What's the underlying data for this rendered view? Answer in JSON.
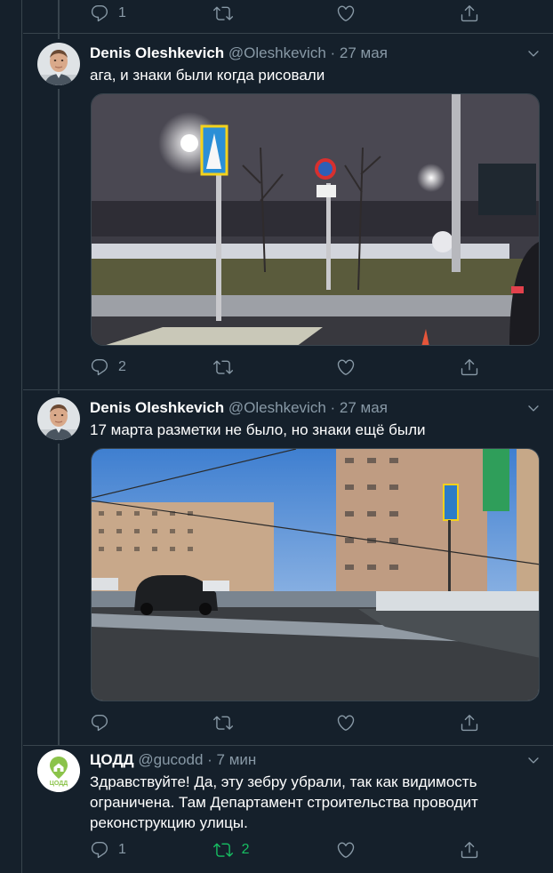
{
  "top_actions": {
    "reply_count": "1",
    "retweet_count": "",
    "like_count": ""
  },
  "tweets": [
    {
      "name": "Denis Oleshkevich",
      "handle": "@Oleshkevich",
      "dot": "·",
      "time": "27 мая",
      "text": "ага, и знаки были когда рисовали",
      "reply_count": "2",
      "retweet_count": "",
      "like_count": ""
    },
    {
      "name": "Denis Oleshkevich",
      "handle": "@Oleshkevich",
      "dot": "·",
      "time": "27 мая",
      "text": "17 марта разметки не было, но знаки ещё были",
      "reply_count": "",
      "retweet_count": "",
      "like_count": ""
    },
    {
      "name": "ЦОДД",
      "handle": "@gucodd",
      "dot": "·",
      "time": "7 мин",
      "text": "Здравствуйте! Да, эту зебру убрали, так как видимость ограничена. Там Департамент строительства проводит реконструкцию улицы.",
      "reply_count": "1",
      "retweet_count": "2",
      "like_count": "",
      "logo_text": "ЦОДД"
    }
  ],
  "colors": {
    "background": "#15202b",
    "border": "#38444d",
    "secondary_text": "#8899a6",
    "retweet_active": "#17bf63",
    "logo_green": "#8bc34a"
  },
  "icons": [
    "reply-icon",
    "retweet-icon",
    "like-icon",
    "share-icon",
    "chevron-down-icon"
  ]
}
